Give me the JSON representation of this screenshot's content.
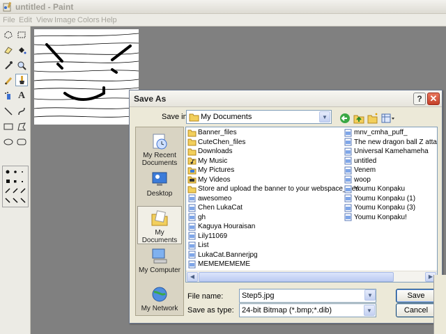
{
  "window": {
    "title": "untitled - Paint"
  },
  "menu": {
    "items": [
      "File",
      "Edit",
      "View",
      "Image",
      "Colors",
      "Help"
    ]
  },
  "toolbox": {
    "tools": [
      "free-form-select",
      "select",
      "eraser",
      "fill-with-color",
      "pick-color",
      "magnifier",
      "pencil",
      "brush",
      "airbrush",
      "text",
      "line",
      "curve",
      "rectangle",
      "polygon",
      "ellipse",
      "rounded-rectangle"
    ],
    "selected_tool": "brush"
  },
  "dialog": {
    "title": "Save As",
    "help_label": "?",
    "close_label": "✕",
    "save_in_label": "Save in:",
    "save_in_value": "My Documents",
    "places": [
      {
        "label": "My Recent Documents"
      },
      {
        "label": "Desktop"
      },
      {
        "label": "My Documents"
      },
      {
        "label": "My Computer"
      },
      {
        "label": "My Network"
      }
    ],
    "files_col1": [
      {
        "name": "Banner_files",
        "type": "folder"
      },
      {
        "name": "CuteChen_files",
        "type": "folder"
      },
      {
        "name": "Downloads",
        "type": "folder"
      },
      {
        "name": "My Music",
        "type": "music"
      },
      {
        "name": "My Pictures",
        "type": "pictures"
      },
      {
        "name": "My Videos",
        "type": "videos"
      },
      {
        "name": "Store and upload the banner to your webspace_files",
        "type": "folder"
      },
      {
        "name": "awesomeo",
        "type": "image"
      },
      {
        "name": "Chen LukaCat",
        "type": "image"
      },
      {
        "name": "gh",
        "type": "image"
      },
      {
        "name": "Kaguya Houraisan",
        "type": "image"
      },
      {
        "name": "Lily11069",
        "type": "image"
      },
      {
        "name": "List",
        "type": "image"
      },
      {
        "name": "LukaCat.Bannerjpg",
        "type": "image"
      },
      {
        "name": "MEMEMEMEME",
        "type": "image"
      }
    ],
    "files_col2": [
      {
        "name": "mnv_cmha_puff_",
        "type": "image"
      },
      {
        "name": "The new dragon ball Z attack! N",
        "type": "image"
      },
      {
        "name": "Universal Kamehameha",
        "type": "image"
      },
      {
        "name": "untitled",
        "type": "image"
      },
      {
        "name": "Venem",
        "type": "image"
      },
      {
        "name": "woop",
        "type": "image"
      },
      {
        "name": "Youmu Konpaku",
        "type": "image"
      },
      {
        "name": "Youmu Konpaku (1)",
        "type": "image"
      },
      {
        "name": "Youmu Konpaku (3)",
        "type": "image"
      },
      {
        "name": "Youmu Konpaku!",
        "type": "image"
      }
    ],
    "file_name_label": "File name:",
    "file_name_value": "Step5.jpg",
    "save_type_label": "Save as type:",
    "save_type_value": "24-bit Bitmap (*.bmp;*.dib)",
    "save_button": "Save",
    "cancel_button": "Cancel"
  },
  "colors": {
    "folder": "#f2cf5c",
    "close": "#c43f28",
    "accent": "#316ac5"
  }
}
